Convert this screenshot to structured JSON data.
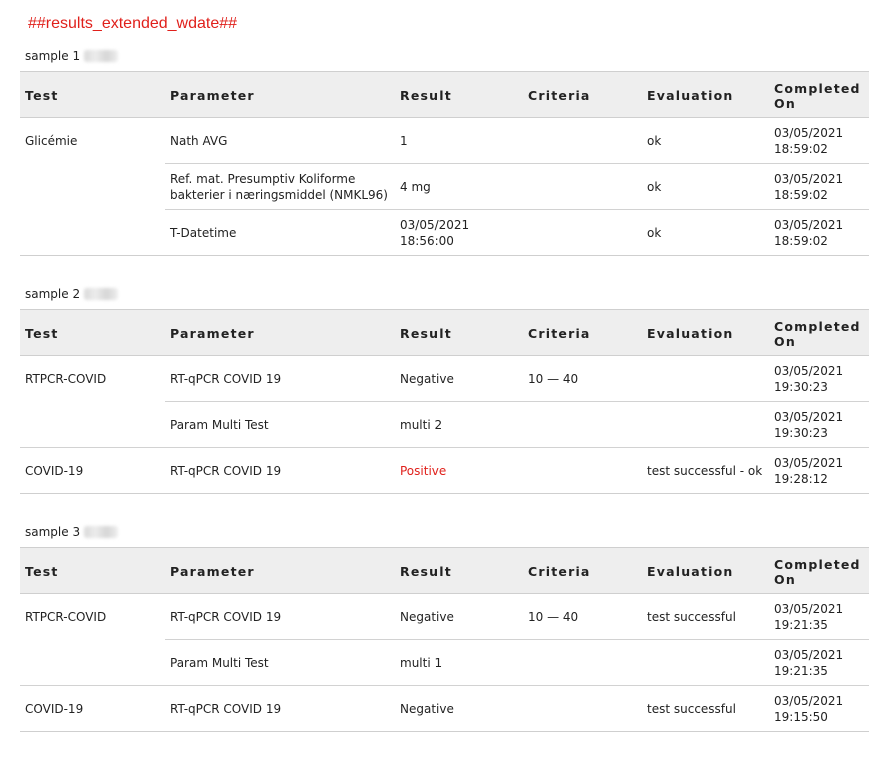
{
  "title": "##results_extended_wdate##",
  "headers": {
    "test": "Test",
    "parameter": "Parameter",
    "result": "Result",
    "criteria": "Criteria",
    "evaluation": "Evaluation",
    "completed": "Completed On"
  },
  "samples": [
    {
      "label": "sample 1",
      "rows": [
        {
          "test": "Glicémie",
          "parameter": "Nath AVG",
          "result": "1",
          "criteria": "",
          "evaluation": "ok",
          "completed_date": "03/05/2021",
          "completed_time": "18:59:02"
        },
        {
          "test": "",
          "parameter": "Ref. mat. Presumptiv Koliforme bakterier i næringsmiddel (NMKL96)",
          "result": "4 mg",
          "criteria": "",
          "evaluation": "ok",
          "completed_date": "03/05/2021",
          "completed_time": "18:59:02"
        },
        {
          "test": "",
          "parameter": "T-Datetime",
          "result": "03/05/2021 18:56:00",
          "criteria": "",
          "evaluation": "ok",
          "completed_date": "03/05/2021",
          "completed_time": "18:59:02"
        }
      ]
    },
    {
      "label": "sample 2",
      "rows": [
        {
          "test": "RTPCR-COVID",
          "parameter": "RT-qPCR COVID 19",
          "result": "Negative",
          "criteria": "10 — 40",
          "evaluation": "",
          "completed_date": "03/05/2021",
          "completed_time": "19:30:23"
        },
        {
          "test": "",
          "parameter": "Param Multi Test",
          "result": "multi 2",
          "criteria": "",
          "evaluation": "",
          "completed_date": "03/05/2021",
          "completed_time": "19:30:23"
        },
        {
          "test": "COVID-19",
          "parameter": "RT-qPCR COVID 19",
          "result": "Positive",
          "criteria": "",
          "evaluation": "test successful - ok",
          "completed_date": "03/05/2021",
          "completed_time": "19:28:12"
        }
      ]
    },
    {
      "label": "sample 3",
      "rows": [
        {
          "test": "RTPCR-COVID",
          "parameter": "RT-qPCR COVID 19",
          "result": "Negative",
          "criteria": "10 — 40",
          "evaluation": "test successful",
          "completed_date": "03/05/2021",
          "completed_time": "19:21:35"
        },
        {
          "test": "",
          "parameter": "Param Multi Test",
          "result": "multi 1",
          "criteria": "",
          "evaluation": "",
          "completed_date": "03/05/2021",
          "completed_time": "19:21:35"
        },
        {
          "test": "COVID-19",
          "parameter": "RT-qPCR COVID 19",
          "result": "Negative",
          "criteria": "",
          "evaluation": "test successful",
          "completed_date": "03/05/2021",
          "completed_time": "19:15:50"
        }
      ]
    }
  ]
}
